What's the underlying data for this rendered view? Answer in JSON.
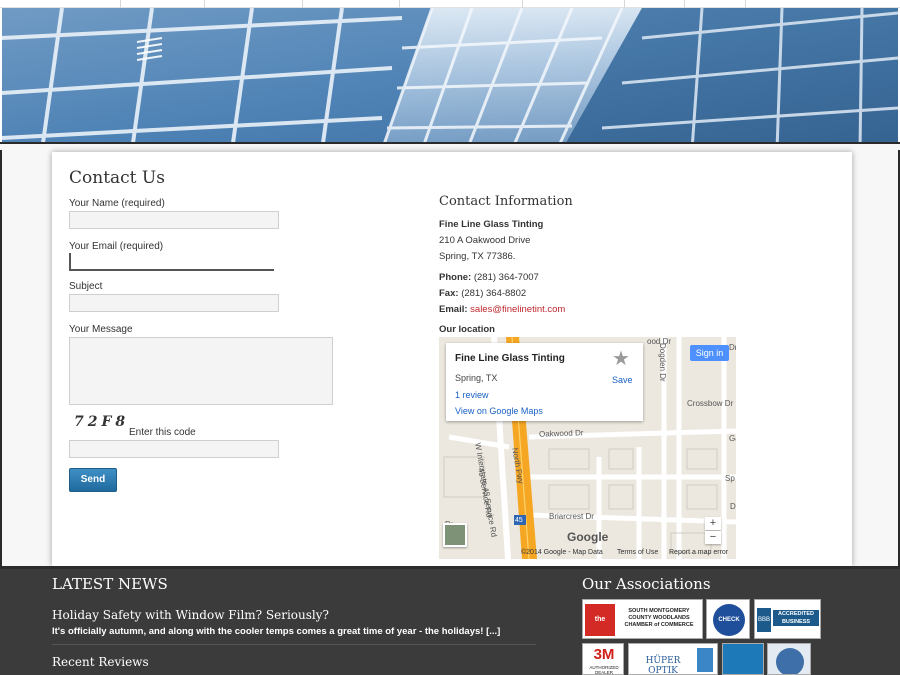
{
  "contact_form": {
    "title": "Contact Us",
    "name_label": "Your Name (required)",
    "email_label": "Your Email (required)",
    "subject_label": "Subject",
    "message_label": "Your Message",
    "captcha_code": "72F8",
    "captcha_label": "Enter this code",
    "send_label": "Send",
    "name_value": "",
    "email_value": "",
    "subject_value": "",
    "message_value": "",
    "captcha_value": ""
  },
  "contact_info": {
    "title": "Contact Information",
    "company": "Fine Line Glass Tinting",
    "address_line1": "210 A Oakwood Drive",
    "address_line2": "Spring, TX 77386.",
    "phone_label": "Phone:",
    "phone": "(281) 364-7007",
    "fax_label": "Fax:",
    "fax": "(281) 364-8802",
    "email_label": "Email:",
    "email": "sales@finelinetint.com",
    "location_label": "Our location"
  },
  "map": {
    "place_name": "Fine Line Glass Tinting",
    "place_city": "Spring, TX",
    "reviews": "1 review",
    "view_link": "View on Google Maps",
    "save_label": "Save",
    "signin_label": "Sign in",
    "zoom_in": "+",
    "zoom_out": "−",
    "logo": "Google",
    "copyright": "©2014 Google - Map Data",
    "terms": "Terms of Use",
    "report": "Report a map error",
    "streets": {
      "oakwood": "Oakwood Dr",
      "crossbow": "Crossbow Dr",
      "briarcrest": "Briarcrest Dr",
      "service_rd_1": "45 Service Rd",
      "service_rd_2": "W Interstate 45 Service Rd",
      "north_fwy": "North Fwy",
      "route_shield": "45",
      "dogden": "Dogden Dr",
      "dr_1": "ood Dr",
      "dr_2": "Dr",
      "dr_3": "Dr",
      "ga": "Ga",
      "d_letter": "D",
      "sp": "Sp"
    },
    "colors": {
      "highway": "#f5a623",
      "land": "#ece8df",
      "road": "#ffffff"
    }
  },
  "footer": {
    "news_heading": "LATEST NEWS",
    "news_title": "Holiday Safety with Window Film? Seriously?",
    "news_excerpt": "It's officially autumn, and along with the cooler temps comes a great time of year - the holidays!",
    "news_more": "[...]",
    "reviews_heading": "Recent Reviews",
    "associations_heading": "Our Associations",
    "badges": [
      {
        "name": "the Chamber",
        "text": "SOUTH MONTGOMERY COUNTY WOODLANDS CHAMBER of COMMERCE"
      },
      {
        "name": "Check Pro",
        "text": "CHECK PRO"
      },
      {
        "name": "BBB",
        "text": "ACCREDITED BUSINESS"
      },
      {
        "name": "3M",
        "text": "AUTHORIZED DEALER"
      },
      {
        "name": "Huper Optik",
        "text": "HÜPER OPTIK"
      },
      {
        "name": "Energy Star",
        "text": ""
      },
      {
        "name": "Skin Cancer Foundation",
        "text": ""
      }
    ]
  },
  "colors": {
    "accent_red": "#c0282f",
    "send_button": "#2a7ab2",
    "footer_bg": "#3b3b3b",
    "link_blue": "#1a62c4"
  }
}
